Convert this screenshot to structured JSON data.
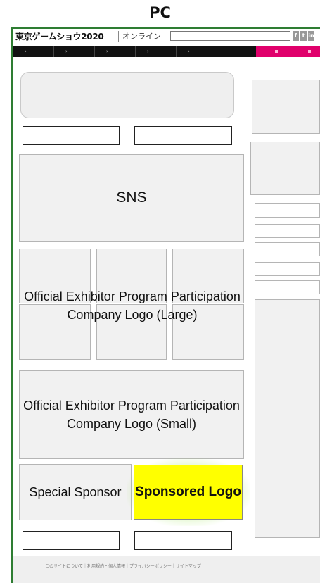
{
  "device_label": "PC",
  "header": {
    "site_logo": "東京ゲームショウ2020",
    "logo_separator": "|",
    "online_text": "オンライン",
    "search_placeholder": "",
    "social": [
      "f",
      "t",
      "in"
    ]
  },
  "nav": {
    "items": [
      "›",
      "›",
      "›",
      "›",
      "›"
    ],
    "accent_color": "#e0006b"
  },
  "main": {
    "sns_label": "SNS",
    "large_logo_label": "Official Exhibitor Program Participation Company Logo (Large)",
    "small_logo_label": "Official Exhibitor Program Participation Company Logo (Small)",
    "special_sponsor_label": "Special Sponsor",
    "sponsored_logo_label": "Sponsored Logo"
  },
  "footer": {
    "links_text": "このサイトについて｜利用規約・個人情報｜プライバシーポリシー｜サイトマップ"
  },
  "colors": {
    "frame_border": "#2e7d32",
    "sponsored_bg": "#ffff00",
    "glow": "#a0e65a"
  }
}
